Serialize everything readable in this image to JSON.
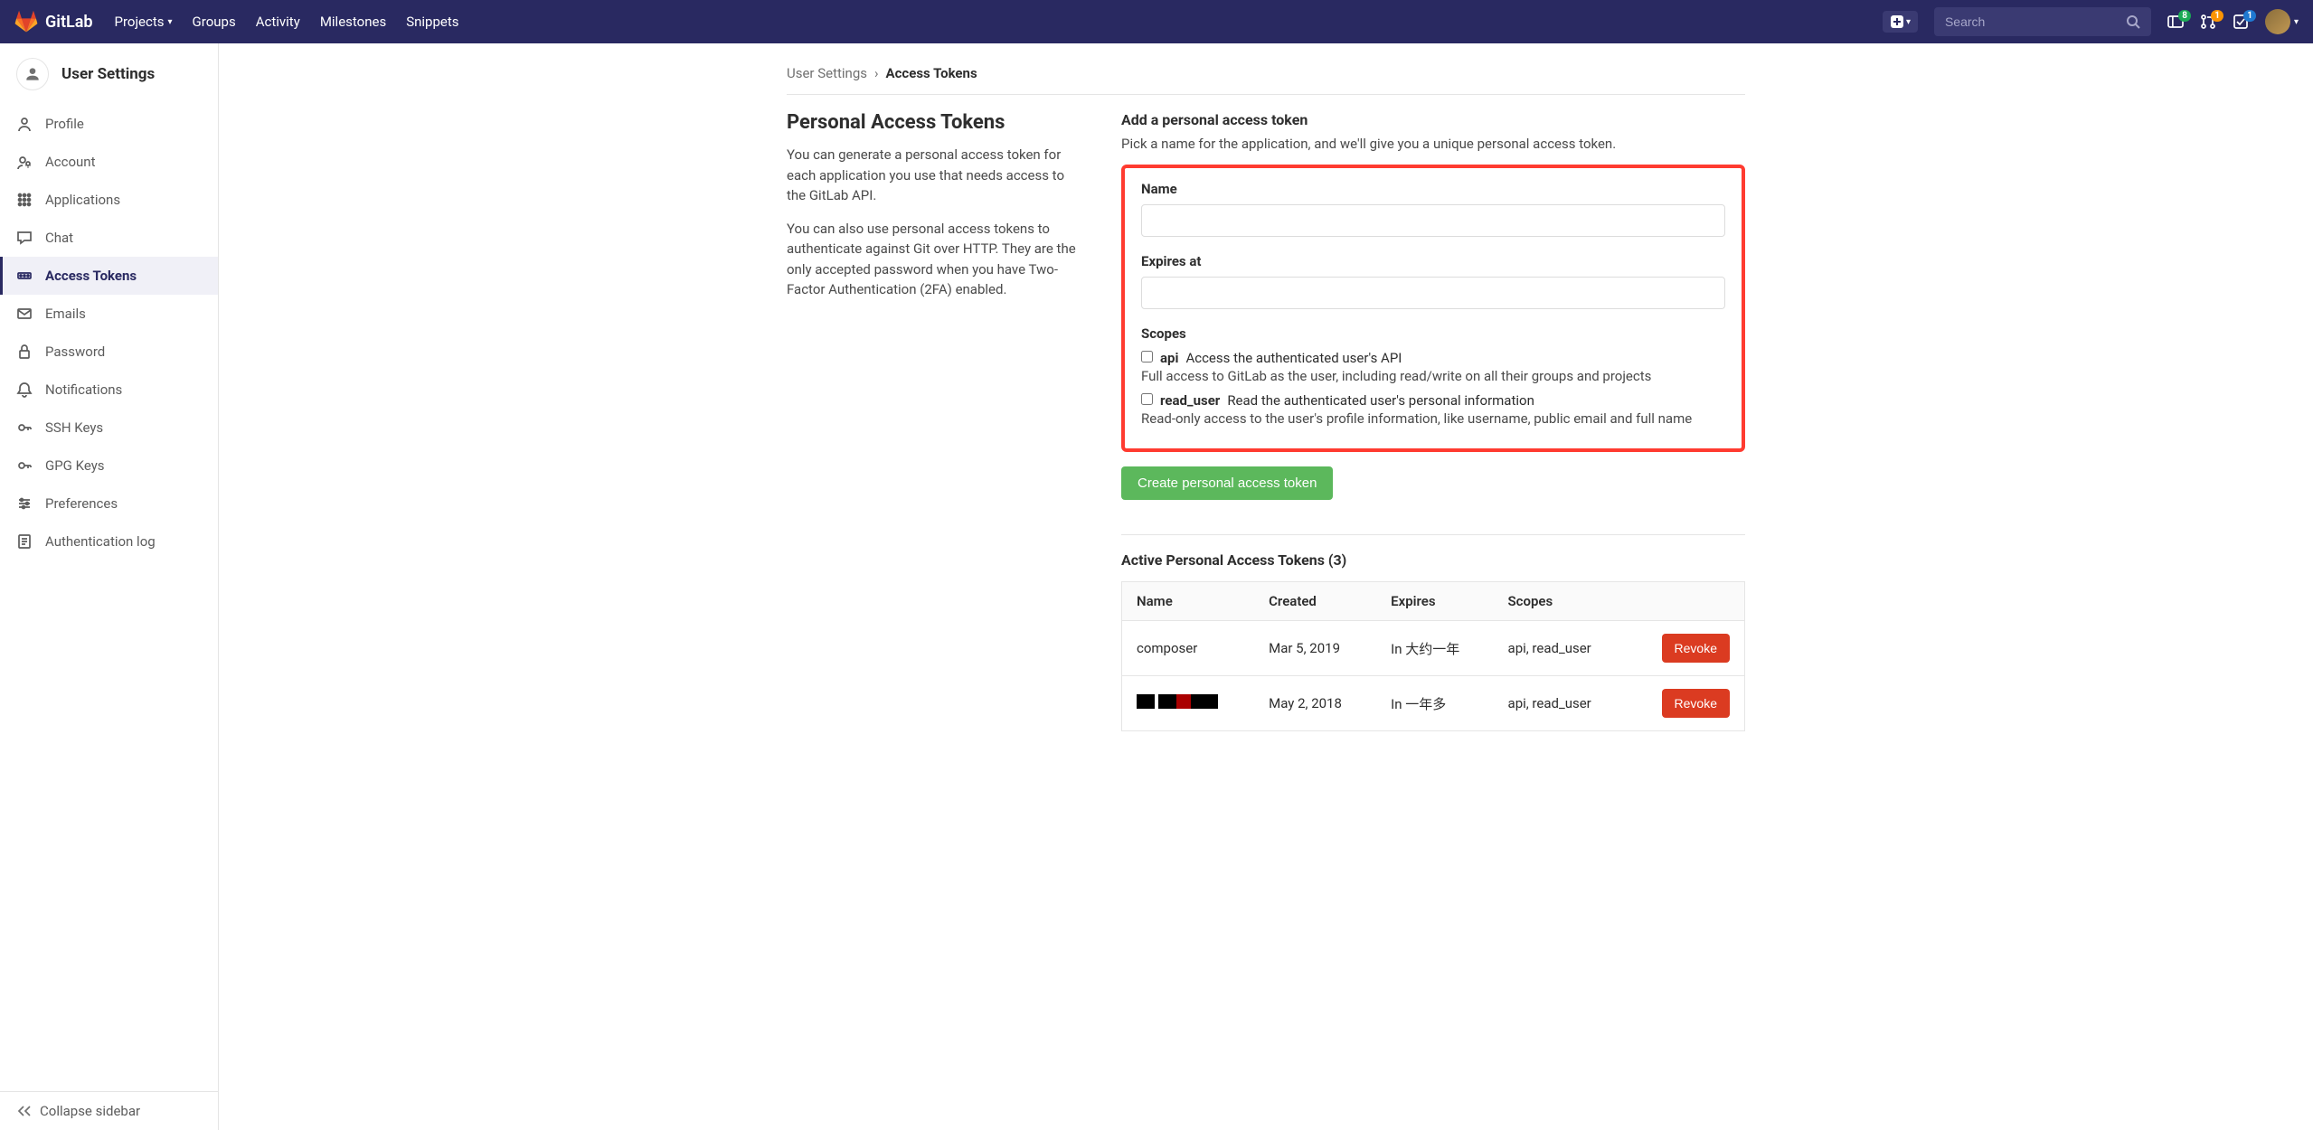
{
  "topnav": {
    "brand": "GitLab",
    "links": {
      "projects": "Projects",
      "groups": "Groups",
      "activity": "Activity",
      "milestones": "Milestones",
      "snippets": "Snippets"
    },
    "search_placeholder": "Search",
    "badges": {
      "issues": "8",
      "merge": "1",
      "todos": "1"
    }
  },
  "sidebar": {
    "title": "User Settings",
    "items": [
      {
        "id": "profile",
        "label": "Profile"
      },
      {
        "id": "account",
        "label": "Account"
      },
      {
        "id": "applications",
        "label": "Applications"
      },
      {
        "id": "chat",
        "label": "Chat"
      },
      {
        "id": "access-tokens",
        "label": "Access Tokens"
      },
      {
        "id": "emails",
        "label": "Emails"
      },
      {
        "id": "password",
        "label": "Password"
      },
      {
        "id": "notifications",
        "label": "Notifications"
      },
      {
        "id": "ssh-keys",
        "label": "SSH Keys"
      },
      {
        "id": "gpg-keys",
        "label": "GPG Keys"
      },
      {
        "id": "preferences",
        "label": "Preferences"
      },
      {
        "id": "auth-log",
        "label": "Authentication log"
      }
    ],
    "collapse": "Collapse sidebar"
  },
  "breadcrumb": {
    "parent": "User Settings",
    "current": "Access Tokens"
  },
  "intro": {
    "heading": "Personal Access Tokens",
    "p1": "You can generate a personal access token for each application you use that needs access to the GitLab API.",
    "p2": "You can also use personal access tokens to authenticate against Git over HTTP. They are the only accepted password when you have Two-Factor Authentication (2FA) enabled."
  },
  "form": {
    "section_title": "Add a personal access token",
    "section_desc": "Pick a name for the application, and we'll give you a unique personal access token.",
    "name_label": "Name",
    "expires_label": "Expires at",
    "scopes_label": "Scopes",
    "scopes": [
      {
        "name": "api",
        "short": "Access the authenticated user's API",
        "desc": "Full access to GitLab as the user, including read/write on all their groups and projects"
      },
      {
        "name": "read_user",
        "short": "Read the authenticated user's personal information",
        "desc": "Read-only access to the user's profile information, like username, public email and full name"
      }
    ],
    "create_label": "Create personal access token"
  },
  "active": {
    "title": "Active Personal Access Tokens (3)",
    "columns": {
      "name": "Name",
      "created": "Created",
      "expires": "Expires",
      "scopes": "Scopes"
    },
    "revoke": "Revoke",
    "rows": [
      {
        "name": "composer",
        "created": "Mar 5, 2019",
        "expires": "In 大约一年",
        "scopes": "api, read_user",
        "redacted": false
      },
      {
        "name": "",
        "created": "May 2, 2018",
        "expires": "In 一年多",
        "scopes": "api, read_user",
        "redacted": true
      }
    ]
  }
}
